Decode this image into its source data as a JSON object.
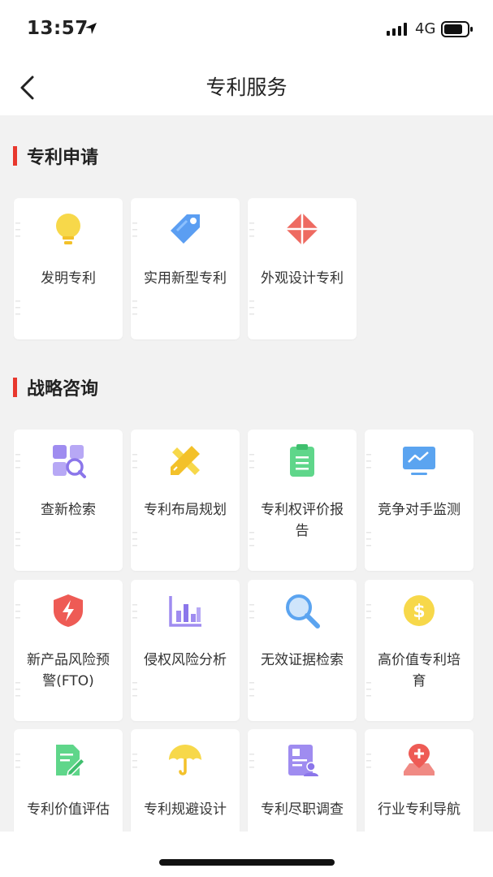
{
  "status": {
    "time": "13:57",
    "network": "4G"
  },
  "nav": {
    "title": "专利服务"
  },
  "sections": [
    {
      "title": "专利申请",
      "items": [
        {
          "label": "发明专利",
          "icon": "lightbulb-icon"
        },
        {
          "label": "实用新型专利",
          "icon": "tag-icon"
        },
        {
          "label": "外观设计专利",
          "icon": "diamond-icon"
        }
      ]
    },
    {
      "title": "战略咨询",
      "items": [
        {
          "label": "查新检索",
          "icon": "search-grid-icon"
        },
        {
          "label": "专利布局规划",
          "icon": "ruler-pencil-icon"
        },
        {
          "label": "专利权评价报告",
          "icon": "clipboard-icon"
        },
        {
          "label": "竞争对手监测",
          "icon": "monitor-icon"
        },
        {
          "label": "新产品风险预警(FTO)",
          "icon": "shield-bolt-icon"
        },
        {
          "label": "侵权风险分析",
          "icon": "bar-chart-icon"
        },
        {
          "label": "无效证据检索",
          "icon": "magnifier-icon"
        },
        {
          "label": "高价值专利培育",
          "icon": "dollar-coin-icon"
        },
        {
          "label": "专利价值评估",
          "icon": "document-pen-icon"
        },
        {
          "label": "专利规避设计",
          "icon": "umbrella-icon"
        },
        {
          "label": "专利尽职调查",
          "icon": "id-document-icon"
        },
        {
          "label": "行业专利导航",
          "icon": "map-pin-icon"
        }
      ]
    }
  ],
  "colors": {
    "accent": "#e8382e"
  }
}
